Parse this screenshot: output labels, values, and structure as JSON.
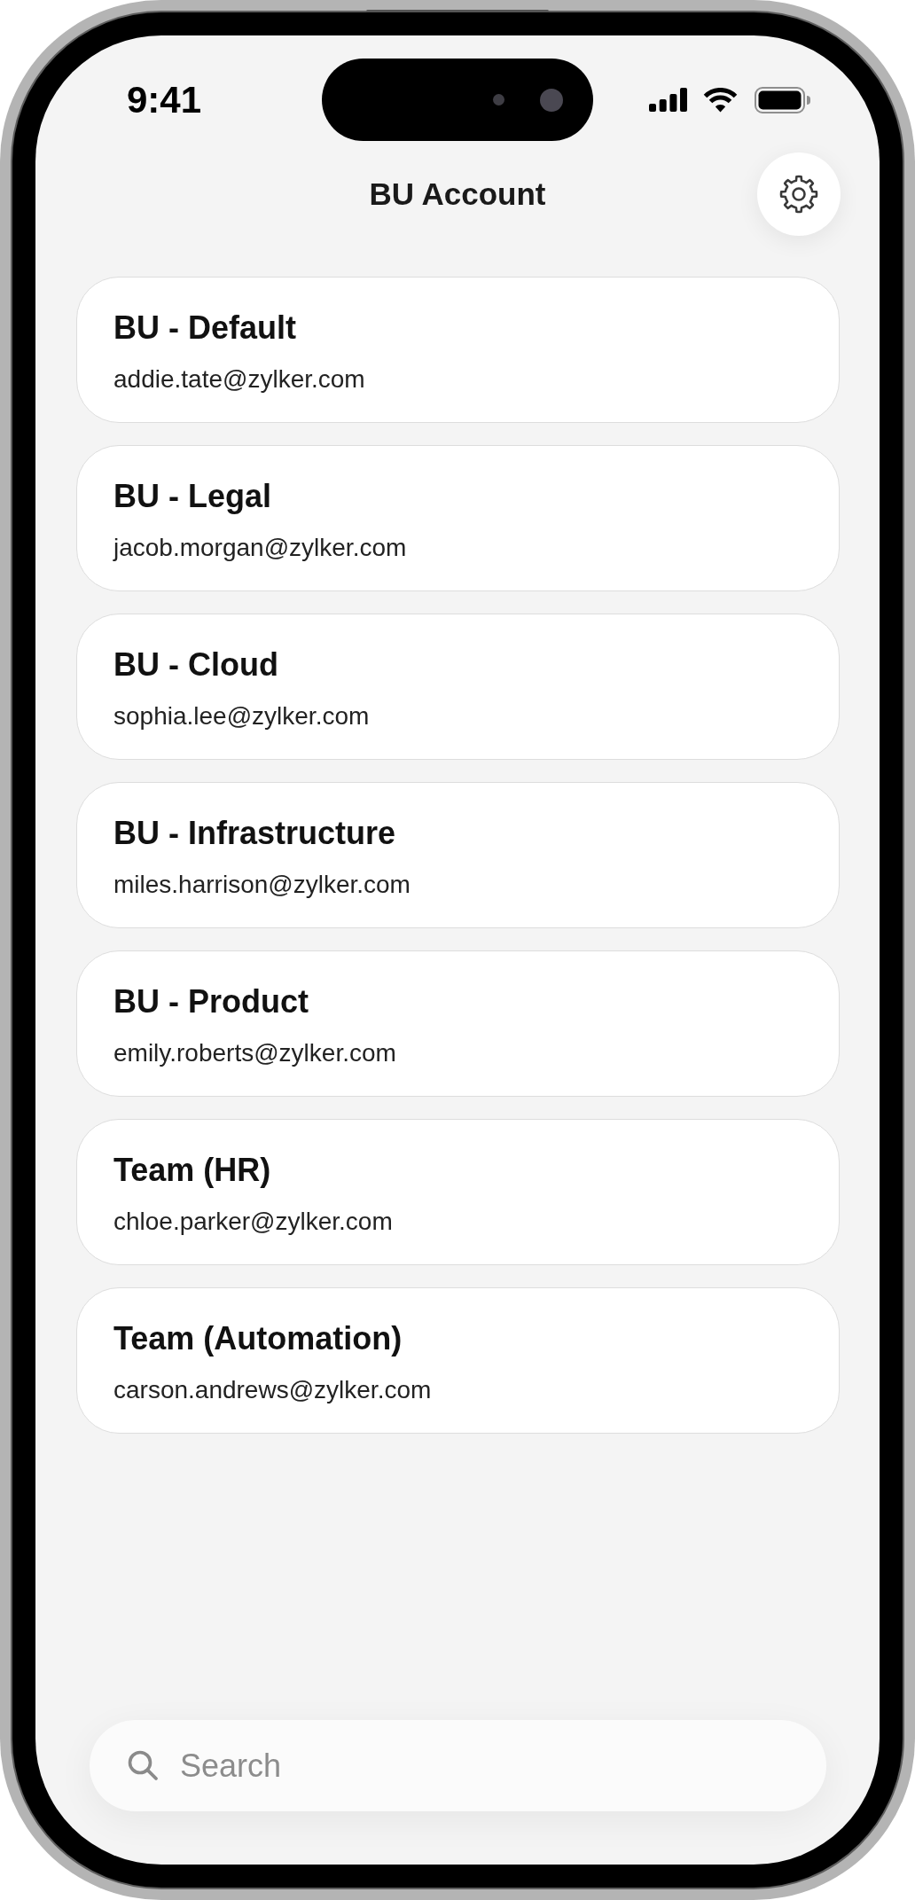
{
  "status_bar": {
    "time": "9:41"
  },
  "header": {
    "title": "BU Account"
  },
  "accounts": [
    {
      "name": "BU - Default",
      "email": "addie.tate@zylker.com"
    },
    {
      "name": "BU - Legal",
      "email": "jacob.morgan@zylker.com"
    },
    {
      "name": "BU - Cloud",
      "email": "sophia.lee@zylker.com"
    },
    {
      "name": "BU - Infrastructure",
      "email": "miles.harrison@zylker.com"
    },
    {
      "name": "BU - Product",
      "email": "emily.roberts@zylker.com"
    },
    {
      "name": "Team (HR)",
      "email": "chloe.parker@zylker.com"
    },
    {
      "name": "Team (Automation)",
      "email": "carson.andrews@zylker.com"
    }
  ],
  "search": {
    "placeholder": "Search"
  }
}
